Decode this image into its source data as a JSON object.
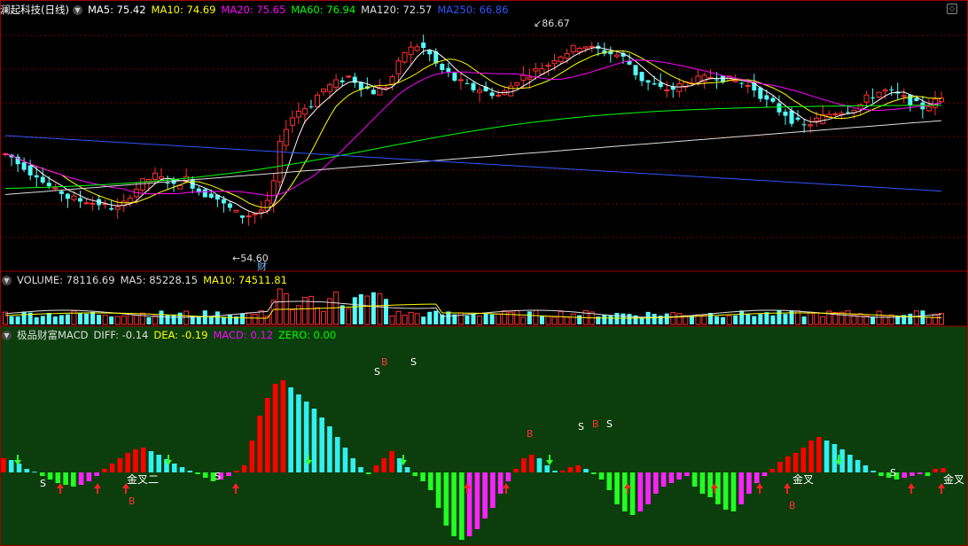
{
  "main": {
    "title": "澜起科技(日线)",
    "indicators": [
      {
        "label": "MA5: 75.42",
        "color": "#ffffff"
      },
      {
        "label": "MA10: 74.69",
        "color": "#ffff00"
      },
      {
        "label": "MA20: 75.65",
        "color": "#ff00ff"
      },
      {
        "label": "MA60: 76.94",
        "color": "#00ff00"
      },
      {
        "label": "MA120: 72.57",
        "color": "#dddddd"
      },
      {
        "label": "MA250: 66.86",
        "color": "#3355ff"
      }
    ],
    "high_label": "86.67",
    "low_label": "54.60",
    "cai_label": "财"
  },
  "volume": {
    "indicators": [
      {
        "label": "VOLUME: 78116.69",
        "color": "#dddddd"
      },
      {
        "label": "MA5: 85228.15",
        "color": "#dddddd"
      },
      {
        "label": "MA10: 74511.81",
        "color": "#ffff00"
      }
    ]
  },
  "macd": {
    "indicators": [
      {
        "label": "极品财富MACD",
        "color": "#dddddd"
      },
      {
        "label": "DIFF: -0.14",
        "color": "#dddddd"
      },
      {
        "label": "DEA: -0.19",
        "color": "#ffff00"
      },
      {
        "label": "MACD: 0.12",
        "color": "#ff00ff"
      },
      {
        "label": "ZERO: 0.00",
        "color": "#00ff00"
      }
    ],
    "jincha_label": "金叉",
    "jincha2_label": "金叉二",
    "b_label": "B",
    "s_label": "S"
  },
  "colors": {
    "up": "#ff3232",
    "down": "#54ffff",
    "bg": "#000000",
    "macd_bg": "#0c3d0c",
    "grid": "#7a0000",
    "hist_red": "#ff0000",
    "hist_cyan": "#30f0f0",
    "hist_magenta": "#ff22ff",
    "hist_green": "#22ff22"
  },
  "chart_data": [
    {
      "type": "candlestick",
      "title": "澜起科技(日线)",
      "ylim": [
        50,
        90
      ],
      "price_path": [
        68,
        67.5,
        66.5,
        66,
        65,
        64.8,
        63.5,
        62.8,
        62,
        61.8,
        61,
        60.8,
        60.5,
        60.5,
        60.2,
        60,
        59.6,
        59.4,
        59.2,
        60,
        61.5,
        62.5,
        63.5,
        64,
        64.5,
        64,
        63.8,
        62.8,
        63.5,
        64,
        63,
        62,
        61.5,
        61.5,
        60.8,
        59.8,
        59.2,
        58.5,
        58,
        58.2,
        58.5,
        59,
        60,
        63.5,
        69.5,
        72.5,
        74,
        75,
        75.5,
        76,
        77.5,
        78.5,
        79,
        79.5,
        80,
        80.5,
        79.8,
        79,
        78.5,
        78,
        78.5,
        79,
        80.5,
        82.5,
        84.5,
        85,
        85.5,
        85,
        84,
        82.5,
        81.5,
        81,
        80,
        79.5,
        79,
        78.5,
        78.5,
        78,
        77.8,
        77.5,
        78,
        79,
        80,
        80.5,
        81,
        81.5,
        82,
        82.5,
        83.5,
        84,
        84.5,
        85,
        85.5,
        85.5,
        85,
        84.8,
        84.5,
        84.2,
        84,
        83.5,
        82.5,
        81,
        80,
        79.5,
        79,
        78.5,
        78.5,
        78.5,
        79,
        79.5,
        80,
        80,
        80.2,
        80.5,
        80.5,
        80.2,
        80,
        79.8,
        79.5,
        79,
        78.5,
        77.5,
        76.5,
        76,
        75,
        74.5,
        73.5,
        73,
        72.5,
        73,
        73.5,
        74,
        74.5,
        74.8,
        75,
        75.2,
        75.5,
        76,
        77,
        77.5,
        78,
        78.2,
        78,
        77.5,
        77,
        76.5,
        76,
        75.5,
        76,
        76.5,
        77
      ],
      "high_marker": 86.67,
      "low_marker": 54.6
    },
    {
      "type": "bar",
      "title": "VOLUME",
      "values": [
        78116.69
      ],
      "ma5": 85228.15,
      "ma10": 74511.81
    },
    {
      "type": "bar",
      "title": "极品财富MACD",
      "macd_path": [
        0.4,
        0.35,
        0.25,
        0.1,
        0.02,
        -0.1,
        -0.2,
        -0.3,
        -0.35,
        -0.4,
        -0.35,
        -0.25,
        -0.1,
        0.1,
        0.25,
        0.4,
        0.55,
        0.65,
        0.7,
        0.6,
        0.5,
        0.38,
        0.25,
        0.15,
        0.05,
        -0.05,
        -0.15,
        -0.25,
        -0.2,
        -0.1,
        0.05,
        0.2,
        0.9,
        1.6,
        2.1,
        2.5,
        2.6,
        2.4,
        2.2,
        2.0,
        1.8,
        1.55,
        1.3,
        1.0,
        0.7,
        0.4,
        0.15,
        -0.05,
        0.2,
        0.4,
        0.6,
        0.4,
        0.15,
        -0.1,
        -0.25,
        -0.5,
        -1.0,
        -1.5,
        -1.8,
        -1.9,
        -1.8,
        -1.6,
        -1.3,
        -1.0,
        -0.6,
        -0.25,
        0.1,
        0.4,
        0.5,
        0.4,
        0.2,
        0.05,
        0.05,
        0.15,
        0.2,
        0.1,
        -0.05,
        -0.2,
        -0.5,
        -0.9,
        -1.1,
        -1.2,
        -1.1,
        -0.9,
        -0.6,
        -0.4,
        -0.3,
        -0.2,
        -0.1,
        -0.4,
        -0.6,
        -0.7,
        -0.9,
        -1.05,
        -1.1,
        -0.9,
        -0.6,
        -0.3,
        -0.1,
        0.1,
        0.3,
        0.45,
        0.55,
        0.7,
        0.9,
        1.0,
        0.9,
        0.8,
        0.65,
        0.5,
        0.35,
        0.2,
        0.05,
        -0.1,
        -0.15,
        -0.2,
        -0.15,
        -0.1,
        -0.05,
        -0.1,
        0.1,
        0.12
      ]
    }
  ]
}
